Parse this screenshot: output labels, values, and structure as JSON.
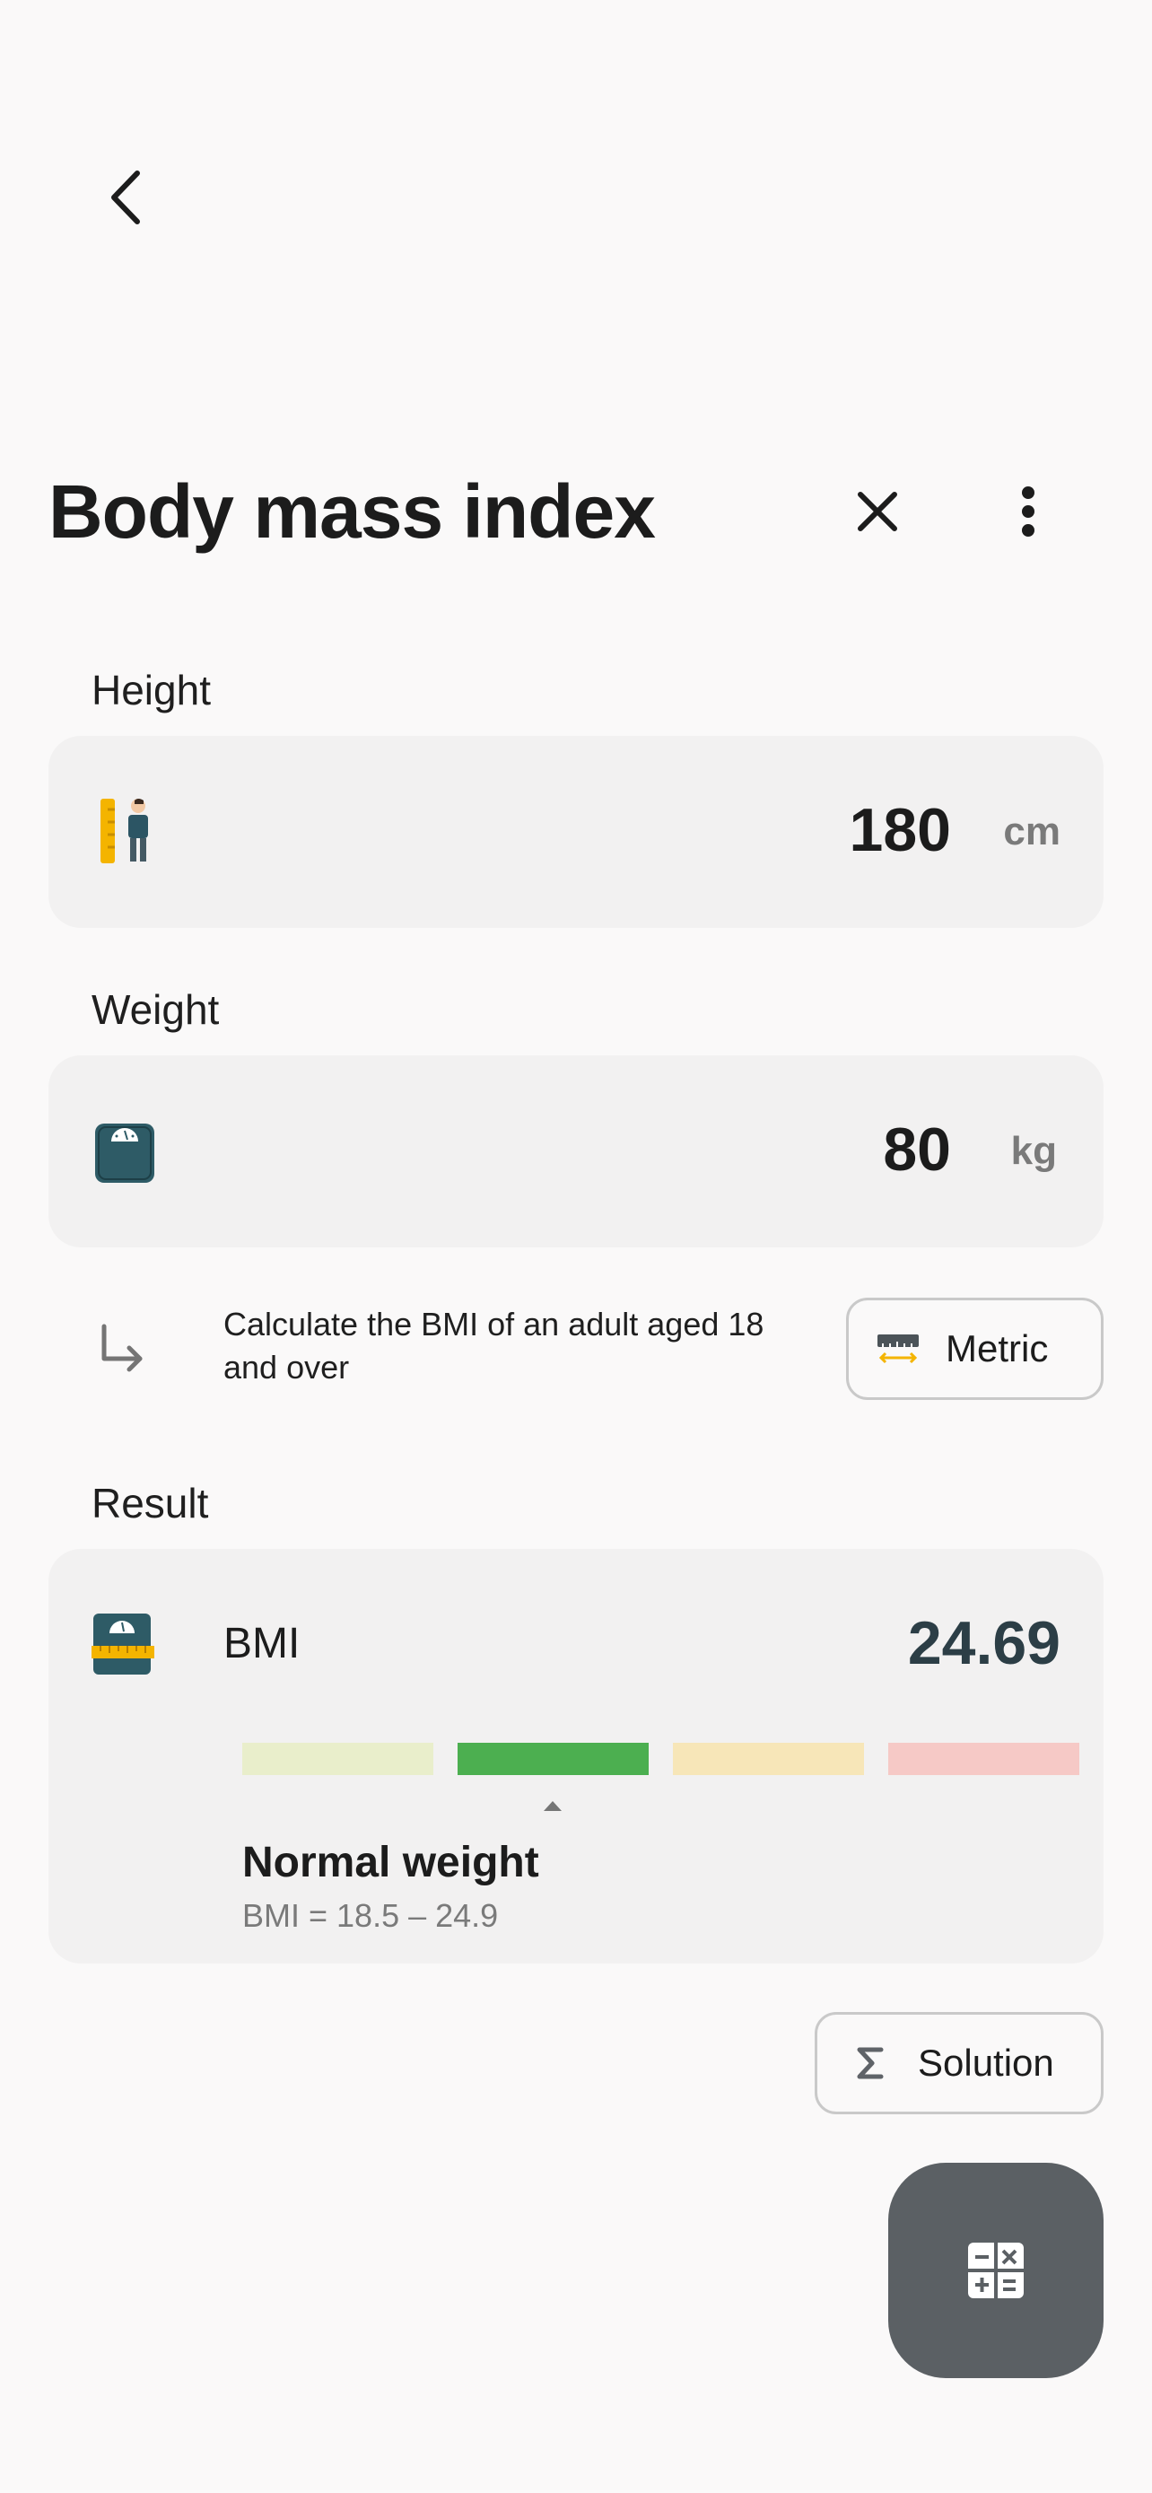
{
  "header": {
    "title": "Body mass index"
  },
  "height": {
    "label": "Height",
    "value": "180",
    "unit": "cm",
    "icon": "height-ruler-person-icon"
  },
  "weight": {
    "label": "Weight",
    "value": "80",
    "unit": "kg",
    "icon": "scale-icon"
  },
  "hint": {
    "text": "Calculate the BMI of an adult aged 18 and over",
    "icon": "arrow-down-right-icon"
  },
  "unit_system": {
    "label": "Metric",
    "icon": "ruler-icon"
  },
  "result": {
    "label": "Result",
    "name": "BMI",
    "value": "24.69",
    "category": "Normal weight",
    "range": "BMI = 18.5 – 24.9",
    "active_segment_index": 1,
    "segments": [
      {
        "color": "#e9eecb"
      },
      {
        "color": "#4caf50"
      },
      {
        "color": "#f7e6b8"
      },
      {
        "color": "#f6c9c6"
      }
    ]
  },
  "solution": {
    "label": "Solution",
    "icon": "sigma-icon"
  },
  "fab": {
    "icon": "calculator-icon"
  },
  "colors": {
    "background": "#faf9f9",
    "card": "#f2f1f1",
    "fab": "#5b6064",
    "accent_dark": "#2c3e46"
  }
}
